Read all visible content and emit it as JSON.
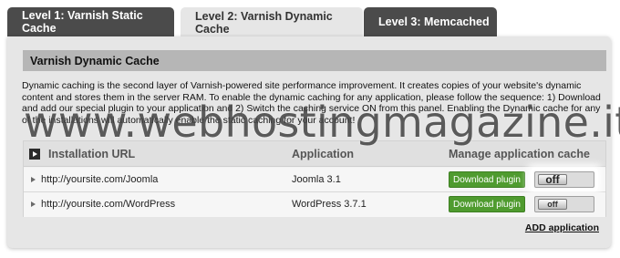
{
  "tabs": [
    {
      "label": "Level 1: Varnish Static Cache",
      "active": false
    },
    {
      "label": "Level 2: Varnish Dynamic Cache",
      "active": true
    },
    {
      "label": "Level 3: Memcached",
      "active": false
    }
  ],
  "section": {
    "title": "Varnish Dynamic Cache",
    "description": "Dynamic caching is the second layer of Varnish-powered site performance improvement. It creates copies of your website's dynamic content and stores them in the server RAM. To enable the dynamic caching for any application, please follow the sequence: 1) Download and add our special plugin to your application and 2) Switch the caching service ON from this panel. Enabling the Dynamic cache for any of the installations will automatically enable the static caching for your account!"
  },
  "table": {
    "headers": {
      "url": "Installation URL",
      "application": "Application",
      "manage": "Manage application cache"
    },
    "rows": [
      {
        "url": "http://yoursite.com/Joomla",
        "application": "Joomla 3.1",
        "button": "Download plugin",
        "toggle": "off"
      },
      {
        "url": "http://yoursite.com/WordPress",
        "application": "WordPress 3.7.1",
        "button": "Download plugin",
        "toggle": "off"
      }
    ]
  },
  "add_application": "ADD application",
  "watermark": "www.webhostingmagazine.it",
  "colors": {
    "tab_dark": "#4b4b4b",
    "panel": "#e6e6e6",
    "section_header": "#b6b6b6",
    "button_green": "#4f9b2f"
  },
  "icons": {
    "expand_all": "play-square-icon",
    "row_caret": "caret-right-icon"
  }
}
